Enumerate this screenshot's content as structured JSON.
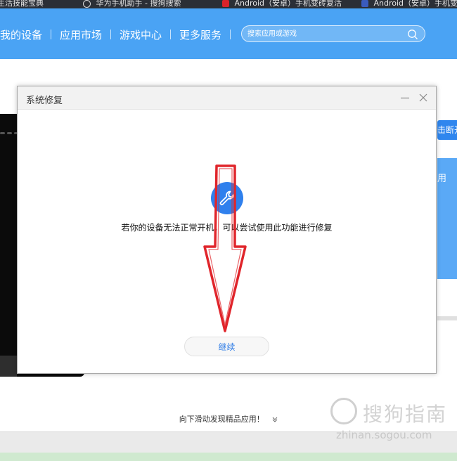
{
  "browser_tabs": [
    {
      "label": "生活技能宝典"
    },
    {
      "label": "华为手机助手 - 搜狗搜索"
    },
    {
      "label": "Android（安卓）手机变砖复活"
    },
    {
      "label": "Android（安卓）手机变砖"
    }
  ],
  "header": {
    "nav": [
      "我的设备",
      "应用市场",
      "游戏中心",
      "更多服务"
    ],
    "search_placeholder": "搜索应用或游戏"
  },
  "background": {
    "right_button": "击断开",
    "right_card": "用",
    "scroll_hint": "向下滑动发现精品应用！"
  },
  "dialog": {
    "title": "系统修复",
    "message": "若你的设备无法正常开机，可以尝试使用此功能进行修复",
    "continue_label": "继续"
  },
  "watermark": {
    "title": "搜狗指南",
    "url": "zhinan.sogou.com"
  },
  "colors": {
    "header_blue": "#4aa3f4",
    "accent_blue": "#2f80ed",
    "annotation_red": "#e0252b"
  }
}
